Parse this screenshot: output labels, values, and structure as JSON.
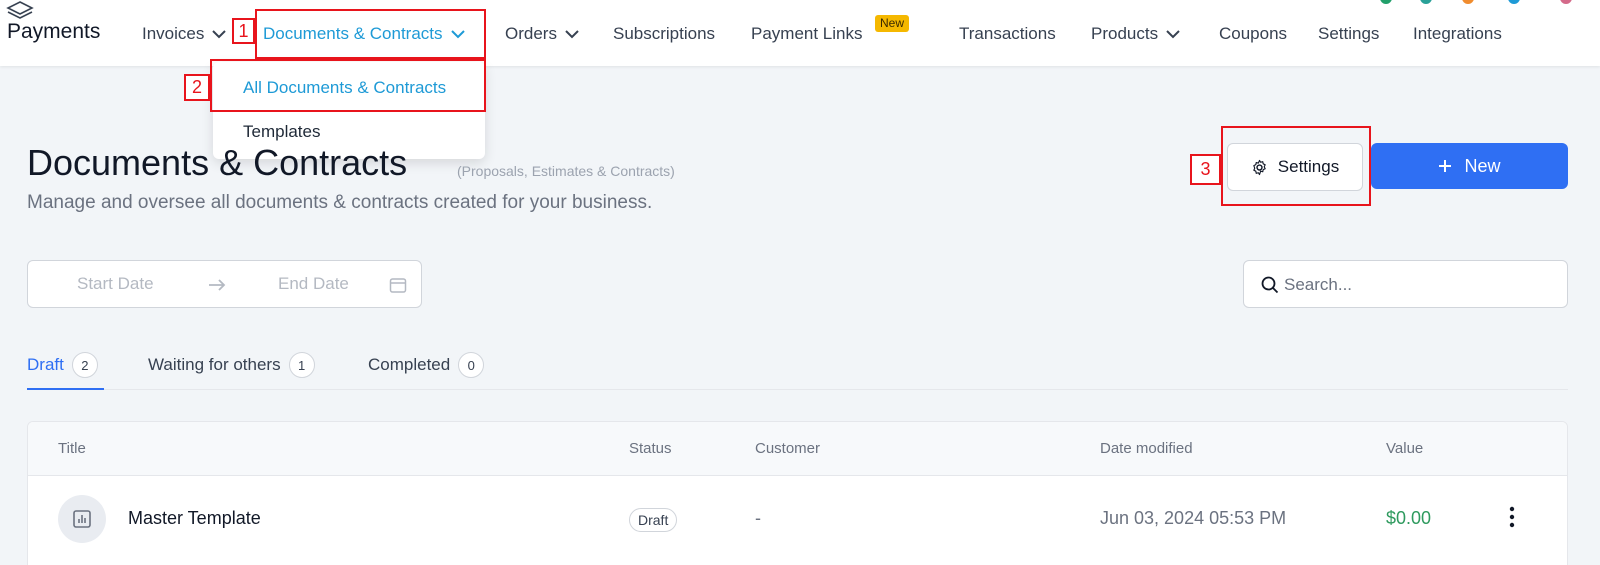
{
  "topnav": {
    "brand": "Payments",
    "items": [
      {
        "label": "Invoices"
      },
      {
        "label": "Documents & Contracts"
      },
      {
        "label": "Orders"
      },
      {
        "label": "Subscriptions"
      },
      {
        "label": "Payment Links"
      },
      {
        "label": "Transactions"
      },
      {
        "label": "Products"
      },
      {
        "label": "Coupons"
      },
      {
        "label": "Settings"
      },
      {
        "label": "Integrations"
      }
    ],
    "new_badge": "New"
  },
  "dropdown": {
    "items": [
      {
        "label": "All Documents & Contracts"
      },
      {
        "label": "Templates"
      }
    ]
  },
  "annotations": {
    "n1": "1",
    "n2": "2",
    "n3": "3"
  },
  "header": {
    "title": "Documents & Contracts",
    "subtitle_small": "(Proposals, Estimates & Contracts)",
    "description": "Manage and oversee all documents & contracts created for your business.",
    "settings_label": "Settings",
    "new_label": "New"
  },
  "filters": {
    "start_date": "Start Date",
    "end_date": "End Date",
    "search_placeholder": "Search..."
  },
  "tabs": [
    {
      "label": "Draft",
      "count": "2"
    },
    {
      "label": "Waiting for others",
      "count": "1"
    },
    {
      "label": "Completed",
      "count": "0"
    }
  ],
  "table": {
    "columns": [
      "Title",
      "Status",
      "Customer",
      "Date modified",
      "Value"
    ],
    "rows": [
      {
        "title": "Master Template",
        "status": "Draft",
        "customer": "-",
        "date": "Jun 03, 2024 05:53 PM",
        "value": "$0.00"
      }
    ]
  },
  "colors": {
    "accent": "#2f6ff3",
    "active_nav": "#1e9ad6",
    "annotation": "#e8141c",
    "value_green": "#2e9a5e",
    "badge": "#f5b800"
  }
}
